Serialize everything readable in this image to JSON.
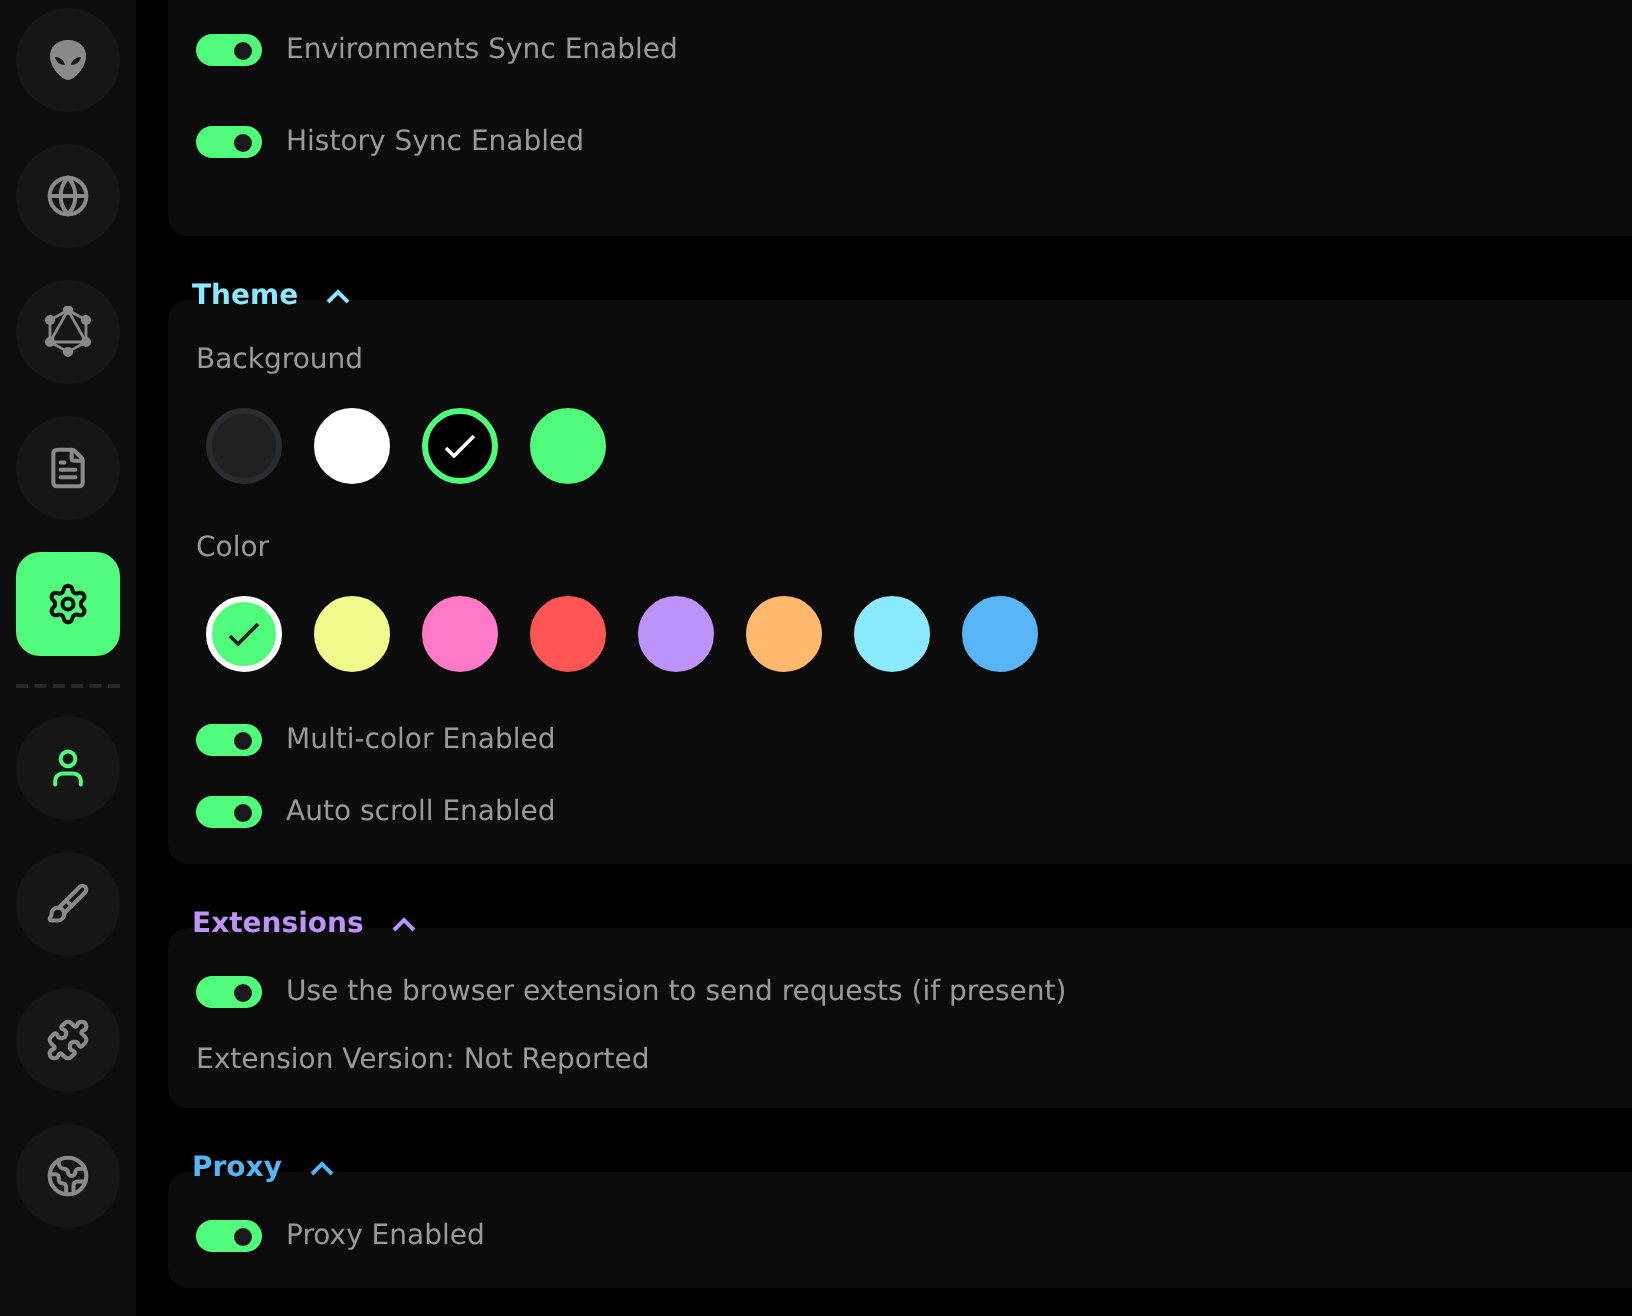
{
  "sidebar": {
    "top_items": [
      {
        "kind": "alien",
        "selected": false
      },
      {
        "kind": "globe",
        "selected": false
      },
      {
        "kind": "graph",
        "selected": false
      },
      {
        "kind": "document",
        "selected": false
      },
      {
        "kind": "settings",
        "selected": true
      }
    ],
    "bottom_items": [
      {
        "kind": "user",
        "selected": false
      },
      {
        "kind": "brush",
        "selected": false
      },
      {
        "kind": "puzzle",
        "selected": false
      },
      {
        "kind": "earth",
        "selected": false
      }
    ]
  },
  "sections": [
    {
      "rows": [
        {
          "kind": "toggle",
          "label": "Environments Sync Enabled",
          "on": true
        },
        {
          "kind": "toggle",
          "label": "History Sync Enabled",
          "on": true
        }
      ]
    },
    {
      "title": "Theme",
      "color": "#8be9fd",
      "expanded": true,
      "rows": [
        {
          "kind": "label",
          "label": "Background"
        },
        {
          "kind": "background_swatches",
          "items": [
            {
              "color": "#202124",
              "selected": false
            },
            {
              "color": "#ffffff",
              "selected": false
            },
            {
              "color": "#000000",
              "selected": true
            },
            {
              "color": "#50fa7b",
              "selected": false
            }
          ]
        },
        {
          "kind": "label",
          "label": "Color"
        },
        {
          "kind": "color_swatches",
          "items": [
            {
              "color": "#50fa7b",
              "selected": true
            },
            {
              "color": "#f1fa8c",
              "selected": false
            },
            {
              "color": "#ff79c6",
              "selected": false
            },
            {
              "color": "#ff5555",
              "selected": false
            },
            {
              "color": "#bd93f9",
              "selected": false
            },
            {
              "color": "#ffb86c",
              "selected": false
            },
            {
              "color": "#8be9fd",
              "selected": false
            },
            {
              "color": "#58b5f5",
              "selected": false
            }
          ]
        },
        {
          "kind": "toggle",
          "label": "Multi-color Enabled",
          "on": true
        },
        {
          "kind": "toggle",
          "label": "Auto scroll Enabled",
          "on": true
        }
      ]
    },
    {
      "title": "Extensions",
      "color": "#bd93f9",
      "expanded": true,
      "rows": [
        {
          "kind": "toggle",
          "label": "Use the browser extension to send requests (if present)",
          "on": true
        },
        {
          "kind": "label",
          "label": "Extension Version: Not Reported"
        }
      ]
    },
    {
      "title": "Proxy",
      "color": "#58b5f5",
      "expanded": true,
      "rows": [
        {
          "kind": "toggle",
          "label": "Proxy Enabled",
          "on": true
        }
      ]
    }
  ]
}
